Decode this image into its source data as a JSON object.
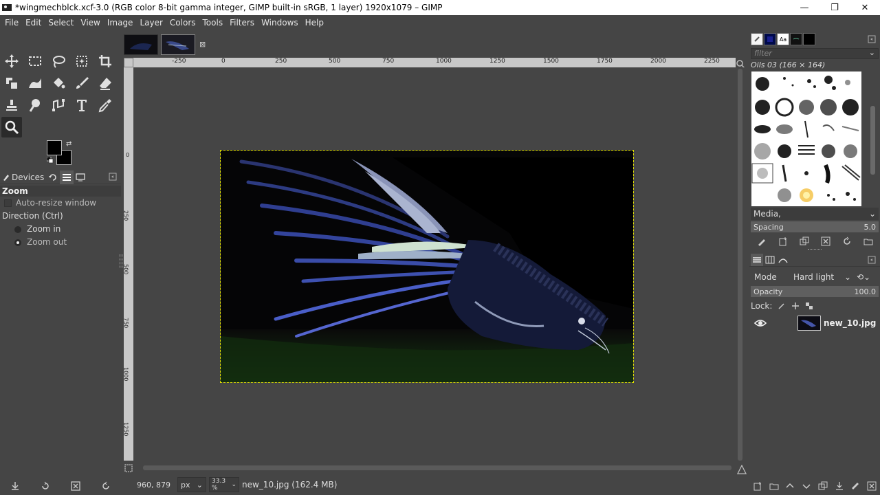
{
  "window": {
    "title": "*wingmechblck.xcf-3.0 (RGB color 8-bit gamma integer, GIMP built-in sRGB, 1 layer) 1920x1079 – GIMP",
    "minimize": "—",
    "restore": "❐",
    "close": "✕"
  },
  "menu": [
    "File",
    "Edit",
    "Select",
    "View",
    "Image",
    "Layer",
    "Colors",
    "Tools",
    "Filters",
    "Windows",
    "Help"
  ],
  "toolbox": {
    "tools": [
      "move-tool",
      "rect-select-tool",
      "lasso-tool",
      "fuzzy-select-tool",
      "crop-tool",
      "transform-tool",
      "warp-tool",
      "bucket-fill-tool",
      "paintbrush-tool",
      "eraser-tool",
      "clone-tool",
      "smudge-tool",
      "paths-tool",
      "text-tool",
      "color-picker-tool",
      "zoom-tool"
    ],
    "active_tool": "zoom-tool",
    "fg_color": "#000000",
    "bg_color": "#000000"
  },
  "dock": {
    "tab_devices": "Devices"
  },
  "tool_options": {
    "title": "Zoom",
    "auto_resize": "Auto-resize window",
    "direction": "Direction  (Ctrl)",
    "zoom_in": "Zoom in",
    "zoom_out": "Zoom out"
  },
  "rulers": {
    "h_labels": [
      "-250",
      "0",
      "250",
      "500",
      "750",
      "1000",
      "1250",
      "1500",
      "1750",
      "2000",
      "2250"
    ],
    "v_labels": [
      "0",
      "250",
      "500",
      "750",
      "1000",
      "1250"
    ]
  },
  "status": {
    "coords": "960, 879",
    "unit": "px",
    "zoom": "33.3 %",
    "message": "new_10.jpg (162.4 MB)"
  },
  "brushes": {
    "filter_placeholder": "filter",
    "title": "Oils 03 (166 × 164)",
    "media": "Media,",
    "spacing_label": "Spacing",
    "spacing_value": "5.0"
  },
  "layers": {
    "mode_label": "Mode",
    "mode_value": "Hard light",
    "opacity_label": "Opacity",
    "opacity_value": "100.0",
    "lock_label": "Lock:",
    "layer_name": "new_10.jpg"
  }
}
